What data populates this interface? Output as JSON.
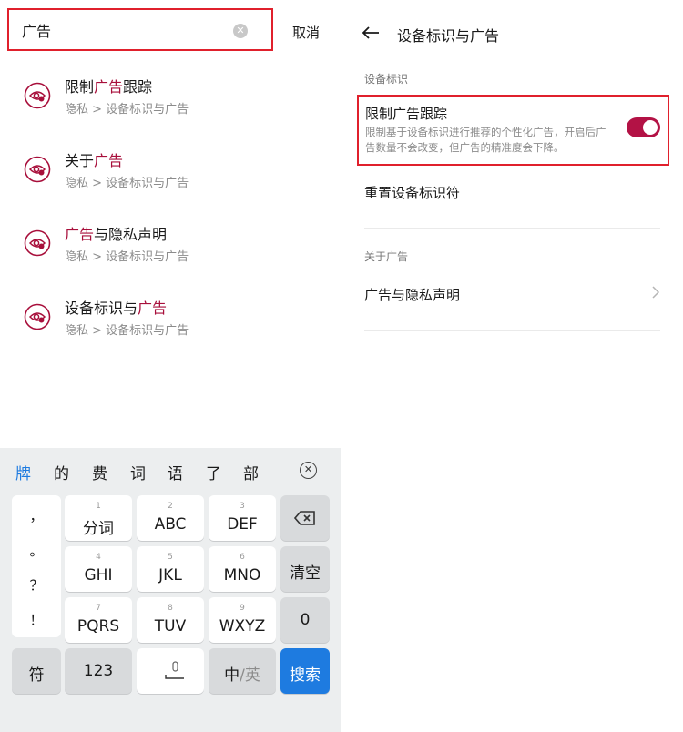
{
  "left": {
    "search": {
      "value": "广告",
      "clear_icon": "clear-circle-icon",
      "cancel_label": "取消"
    },
    "results": [
      {
        "pre": "限制",
        "hl": "广告",
        "post": "跟踪",
        "path": "隐私 > 设备标识与广告",
        "icon": "ad-privacy-icon"
      },
      {
        "pre": "关于",
        "hl": "广告",
        "post": "",
        "path": "隐私 > 设备标识与广告",
        "icon": "ad-privacy-icon"
      },
      {
        "pre": "",
        "hl": "广告",
        "post": "与隐私声明",
        "path": "隐私 > 设备标识与广告",
        "icon": "ad-privacy-icon"
      },
      {
        "pre": "设备标识与",
        "hl": "广告",
        "post": "",
        "path": "隐私 > 设备标识与广告",
        "icon": "ad-privacy-icon"
      }
    ]
  },
  "keyboard": {
    "candidates": [
      "牌",
      "的",
      "费",
      "词",
      "语",
      "了",
      "部"
    ],
    "collapse_icon": "collapse-keyboard-icon",
    "punctuation": [
      "，",
      "。",
      "？",
      "！"
    ],
    "keys": {
      "k1": {
        "num": "1",
        "label": "分词"
      },
      "k2": {
        "num": "2",
        "label": "ABC"
      },
      "k3": {
        "num": "3",
        "label": "DEF"
      },
      "k4": {
        "num": "4",
        "label": "GHI"
      },
      "k5": {
        "num": "5",
        "label": "JKL"
      },
      "k6": {
        "num": "6",
        "label": "MNO"
      },
      "k7": {
        "num": "7",
        "label": "PQRS"
      },
      "k8": {
        "num": "8",
        "label": "TUV"
      },
      "k9": {
        "num": "9",
        "label": "WXYZ"
      },
      "clear": "清空",
      "zero": "0",
      "symbols": "符",
      "num123": "123",
      "lang_cn": "中",
      "lang_sep": "/",
      "lang_en": "英",
      "search": "搜索",
      "backspace_icon": "backspace-icon",
      "space_icon": "space-microphone-icon"
    }
  },
  "right": {
    "title": "设备标识与广告",
    "back_icon": "back-arrow-icon",
    "section1": "设备标识",
    "limit_title": "限制广告跟踪",
    "limit_desc": "限制基于设备标识进行推荐的个性化广告，开启后广告数量不会改变，但广告的精准度会下降。",
    "limit_on": true,
    "reset_label": "重置设备标识符",
    "section2": "关于广告",
    "privacy_label": "广告与隐私声明",
    "chevron_icon": "chevron-right-icon"
  },
  "colors": {
    "accent": "#b31245",
    "highlight_text": "#a80f3b",
    "annotation_border": "#e0202c",
    "keyboard_blue": "#1e7be0"
  }
}
